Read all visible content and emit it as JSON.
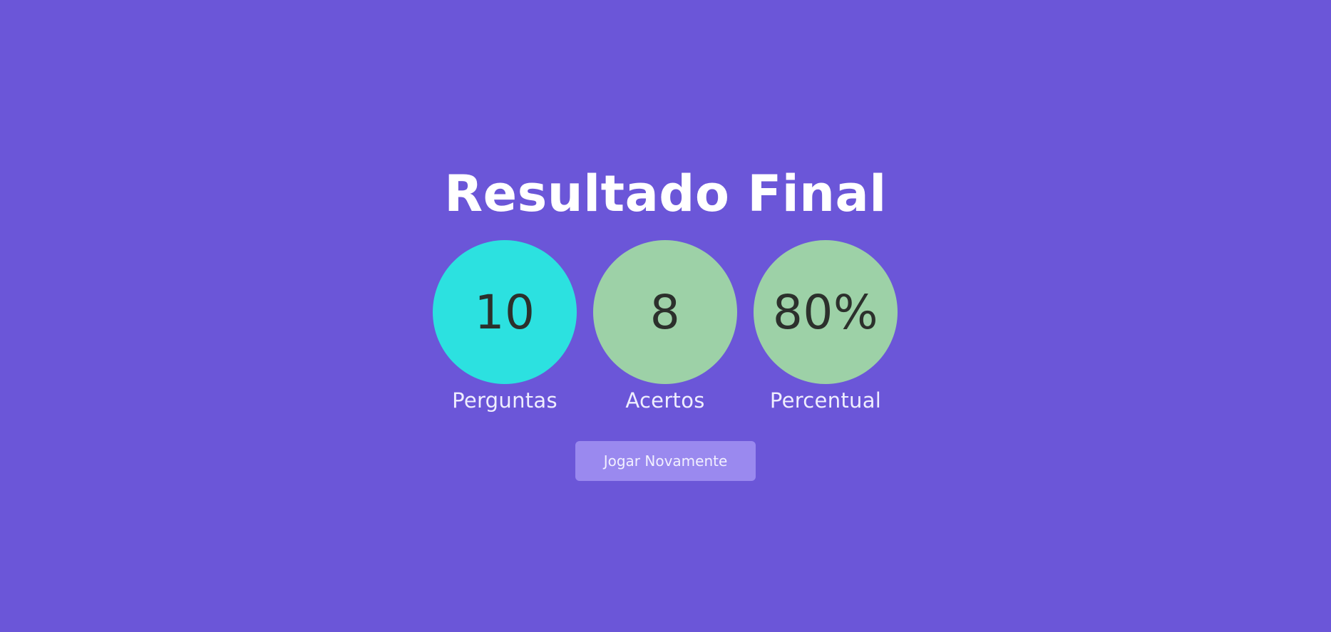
{
  "title": "Resultado Final",
  "stats": [
    {
      "value": "10",
      "label": "Perguntas",
      "color": "#2ce1e0"
    },
    {
      "value": "8",
      "label": "Acertos",
      "color": "#9dd1a7"
    },
    {
      "value": "80%",
      "label": "Percentual",
      "color": "#9dd1a7"
    }
  ],
  "button": {
    "label": "Jogar Novamente",
    "color": "#9a89ef"
  },
  "colors": {
    "background": "#6b56d8"
  }
}
